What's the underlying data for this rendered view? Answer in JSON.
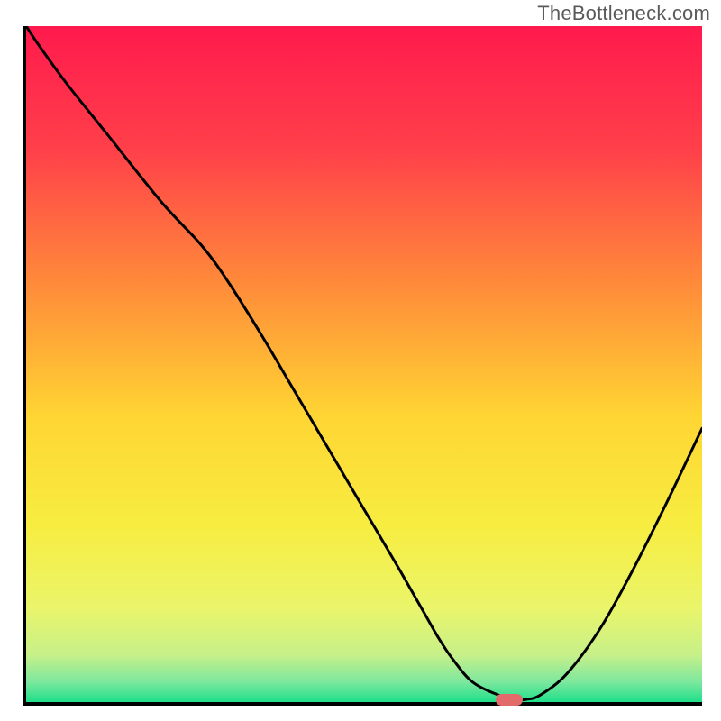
{
  "watermark": "TheBottleneck.com",
  "chart_data": {
    "type": "line",
    "title": "",
    "xlabel": "",
    "ylabel": "",
    "xlim": [
      0,
      1
    ],
    "ylim": [
      0,
      1
    ],
    "grid": false,
    "series": [
      {
        "name": "curve",
        "x": [
          0.0,
          0.02,
          0.06,
          0.12,
          0.2,
          0.26,
          0.3,
          0.35,
          0.4,
          0.45,
          0.5,
          0.55,
          0.59,
          0.61,
          0.63,
          0.66,
          0.7,
          0.73,
          0.74,
          0.76,
          0.8,
          0.85,
          0.9,
          0.95,
          1.0
        ],
        "y": [
          1.0,
          0.97,
          0.915,
          0.84,
          0.74,
          0.675,
          0.62,
          0.54,
          0.455,
          0.37,
          0.285,
          0.2,
          0.13,
          0.095,
          0.065,
          0.03,
          0.01,
          0.004,
          0.004,
          0.01,
          0.042,
          0.11,
          0.2,
          0.3,
          0.405
        ]
      }
    ],
    "marker": {
      "x": 0.715,
      "y": 0.004
    },
    "background_gradient": {
      "type": "linear-vertical",
      "stops": [
        {
          "offset": 0.0,
          "color": "#ff1a4d"
        },
        {
          "offset": 0.18,
          "color": "#ff3f4a"
        },
        {
          "offset": 0.38,
          "color": "#ff8a3a"
        },
        {
          "offset": 0.58,
          "color": "#ffd633"
        },
        {
          "offset": 0.74,
          "color": "#f7ed41"
        },
        {
          "offset": 0.86,
          "color": "#eaf56a"
        },
        {
          "offset": 0.93,
          "color": "#c7f089"
        },
        {
          "offset": 0.97,
          "color": "#7de89e"
        },
        {
          "offset": 1.0,
          "color": "#1fdf8a"
        }
      ]
    }
  }
}
